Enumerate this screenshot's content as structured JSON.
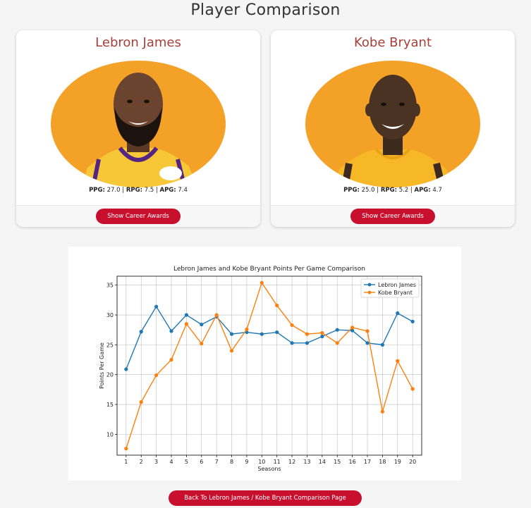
{
  "page": {
    "title": "Player Comparison"
  },
  "players": [
    {
      "name": "Lebron James",
      "ppg_label": "PPG:",
      "ppg": "27.0",
      "rpg_label": "RPG:",
      "rpg": "7.5",
      "apg_label": "APG:",
      "apg": "7.4",
      "sep": "|",
      "button": "Show Career Awards"
    },
    {
      "name": "Kobe Bryant",
      "ppg_label": "PPG:",
      "ppg": "25.0",
      "rpg_label": "RPG:",
      "rpg": "5.2",
      "apg_label": "APG:",
      "apg": "4.7",
      "sep": "|",
      "button": "Show Career Awards"
    }
  ],
  "back_button": "Back To Lebron James / Kobe Bryant Comparison Page",
  "colors": {
    "accent": "#c8102e",
    "name": "#a5403b",
    "portrait_bg": "#f4a128",
    "series1": "#1f77b4",
    "series2": "#ff7f0e"
  },
  "chart_data": {
    "type": "line",
    "title": "Lebron James and Kobe Bryant Points Per Game Comparison",
    "xlabel": "Seasons",
    "ylabel": "Points Per Game",
    "x": [
      1,
      2,
      3,
      4,
      5,
      6,
      7,
      8,
      9,
      10,
      11,
      12,
      13,
      14,
      15,
      16,
      17,
      18,
      19,
      20
    ],
    "xlim": [
      0.4,
      20.6
    ],
    "ylim": [
      6.5,
      36.5
    ],
    "yticks": [
      10,
      15,
      20,
      25,
      30,
      35
    ],
    "grid": true,
    "legend_position": "top-right",
    "series": [
      {
        "name": "Lebron James",
        "color": "#1f77b4",
        "values": [
          20.9,
          27.2,
          31.4,
          27.3,
          30.0,
          28.4,
          29.7,
          26.8,
          27.1,
          26.8,
          27.1,
          25.3,
          25.3,
          26.4,
          27.5,
          27.4,
          25.3,
          25.0,
          30.3,
          28.9
        ]
      },
      {
        "name": "Kobe Bryant",
        "color": "#ff7f0e",
        "values": [
          7.6,
          15.4,
          19.9,
          22.5,
          28.5,
          25.2,
          30.0,
          24.0,
          27.6,
          35.4,
          31.6,
          28.3,
          26.8,
          27.0,
          25.3,
          27.9,
          27.3,
          13.8,
          22.3,
          17.6
        ]
      }
    ]
  }
}
